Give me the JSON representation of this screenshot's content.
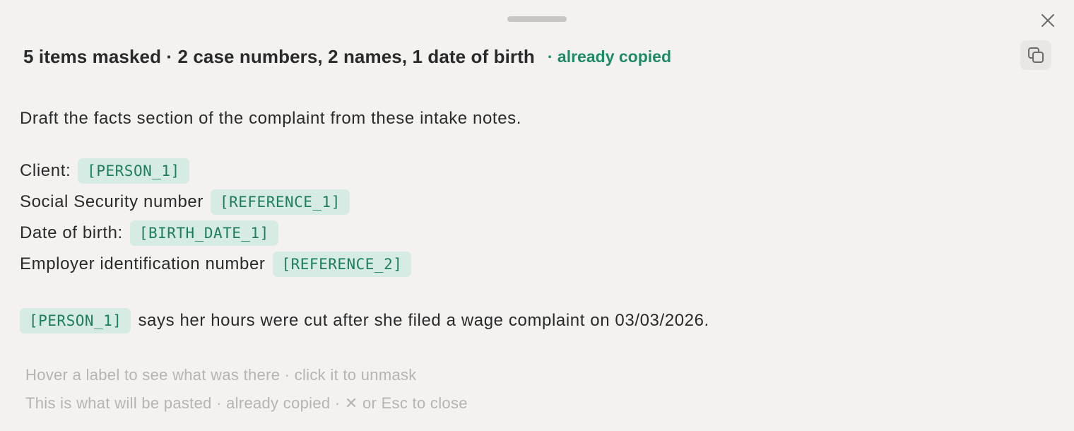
{
  "summary": {
    "text": "5 items masked · 2 case numbers, 2 names, 1 date of birth",
    "status": "· already copied"
  },
  "body": {
    "instruction": "Draft the facts section of the complaint from these intake notes.",
    "fields": [
      {
        "label": "Client:",
        "token": "[PERSON_1]"
      },
      {
        "label": "Social Security number",
        "token": "[REFERENCE_1]"
      },
      {
        "label": "Date of birth:",
        "token": "[BIRTH_DATE_1]"
      },
      {
        "label": "Employer identification number",
        "token": "[REFERENCE_2]"
      }
    ],
    "sentence": {
      "token": "[PERSON_1]",
      "text": "says her hours were cut after she filed a wage complaint on 03/03/2026."
    }
  },
  "hints": {
    "line1": "Hover a label to see what was there · click it to unmask",
    "line2": "This is what will be pasted · already copied · ✕ or Esc to close"
  },
  "icons": {
    "close": "close-icon",
    "copy": "copy-icon"
  },
  "colors": {
    "background": "#f4f2f0",
    "accent": "#1f8a68",
    "mask_bg": "#d6ebe3",
    "mask_text": "#1f7d5f",
    "hint_text": "#b6b4b2"
  }
}
